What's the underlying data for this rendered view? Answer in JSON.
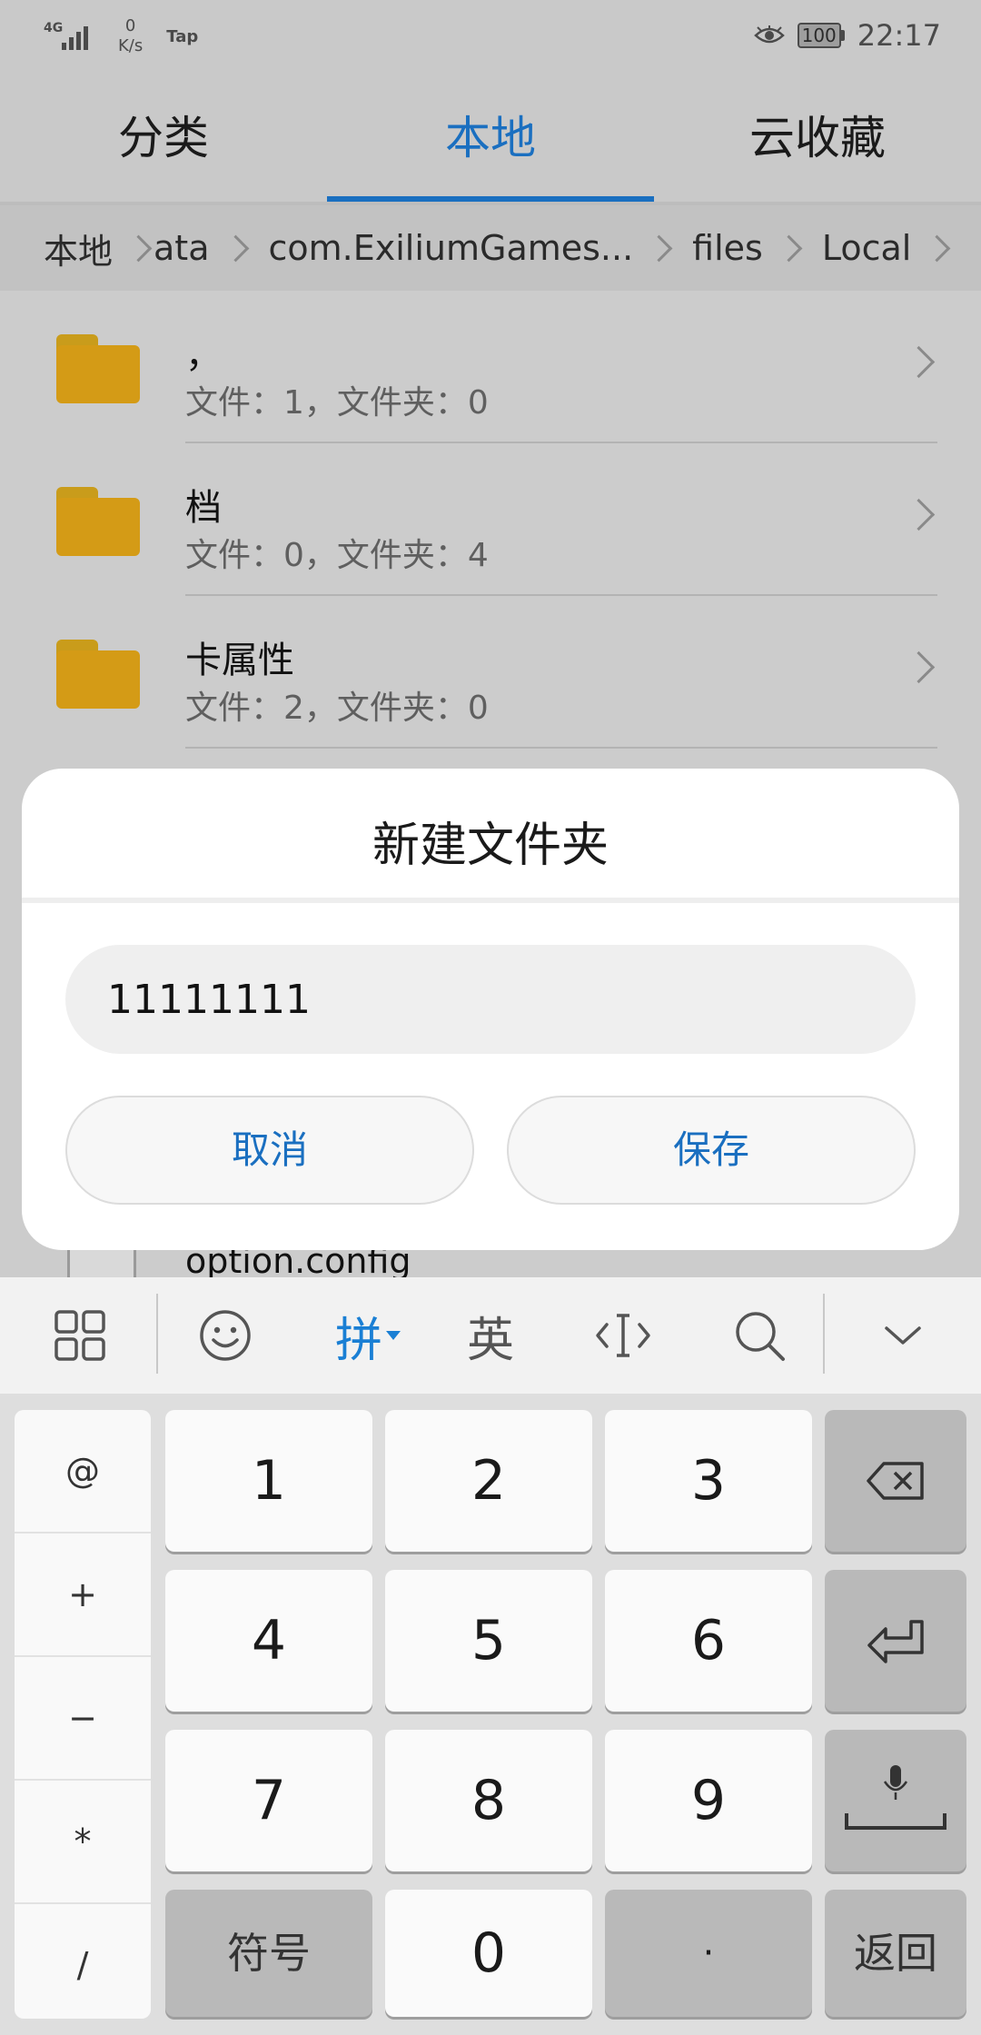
{
  "status_bar": {
    "network_label": "4G",
    "speed_value": "0",
    "speed_unit": "K/s",
    "app_badge": "Tap",
    "eye_icon": "eye-icon",
    "battery": "100",
    "time": "22:17"
  },
  "tabs": [
    {
      "label": "分类",
      "active": false
    },
    {
      "label": "本地",
      "active": true
    },
    {
      "label": "云收藏",
      "active": false
    }
  ],
  "breadcrumb": [
    "本地",
    "ata",
    "com.ExiliumGames...",
    "files",
    "Local"
  ],
  "files": [
    {
      "name": "，",
      "meta": "文件：1，文件夹：0"
    },
    {
      "name": "档",
      "meta": "文件：0，文件夹：4"
    },
    {
      "name": "卡属性",
      "meta": "文件：2，文件夹：0"
    }
  ],
  "peek_file": {
    "name": "option.config"
  },
  "dialog": {
    "title": "新建文件夹",
    "input_value": "11111111",
    "cancel_label": "取消",
    "save_label": "保存"
  },
  "keyboard_toolbar": {
    "items": [
      "grid-icon",
      "emoji-icon",
      "拼",
      "英",
      "cursor-icon",
      "search-icon",
      "collapse-icon"
    ],
    "pinyin_label": "拼",
    "english_label": "英"
  },
  "keyboard": {
    "side_keys": [
      "@",
      "+",
      "−",
      "*",
      "/"
    ],
    "digits": [
      "1",
      "2",
      "3",
      "4",
      "5",
      "6",
      "7",
      "8",
      "9",
      "0"
    ],
    "symbols_label": "符号",
    "dot_label": "·",
    "return_label": "返回"
  },
  "colors": {
    "accent": "#1a6fc0",
    "folder": "#d49b16",
    "dim_background": "#cccccc"
  }
}
